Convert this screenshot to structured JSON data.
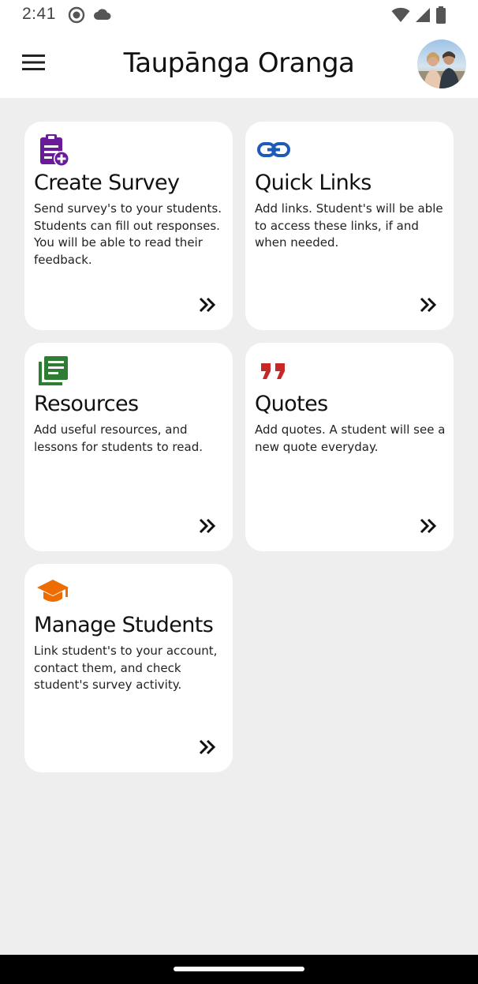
{
  "status_bar": {
    "time": "2:41",
    "left_icons": [
      "github-icon",
      "cloud-icon"
    ],
    "right_icons": [
      "wifi-icon",
      "signal-icon",
      "battery-icon"
    ]
  },
  "app_bar": {
    "menu_icon": "menu-icon",
    "title": "Taupānga Oranga",
    "avatar": "user-avatar"
  },
  "cards": [
    {
      "id": "create-survey",
      "icon": "clipboard-add-icon",
      "icon_color": "#6a1b9a",
      "title": "Create Survey",
      "description": "Send survey's to your students. Students can fill out responses. You will be able to read their feedback.",
      "arrow": "double-chevron-right-icon"
    },
    {
      "id": "quick-links",
      "icon": "link-icon",
      "icon_color": "#1e5bb8",
      "title": "Quick Links",
      "description": "Add links. Student's will be able to access these links, if and when needed.",
      "arrow": "double-chevron-right-icon"
    },
    {
      "id": "resources",
      "icon": "library-books-icon",
      "icon_color": "#2e7d32",
      "title": "Resources",
      "description": "Add useful resources, and lessons for students to read.",
      "arrow": "double-chevron-right-icon"
    },
    {
      "id": "quotes",
      "icon": "quote-icon",
      "icon_color": "#c62828",
      "title": "Quotes",
      "description": "Add quotes. A student will see a new quote everyday.",
      "arrow": "double-chevron-right-icon"
    },
    {
      "id": "manage-students",
      "icon": "graduation-cap-icon",
      "icon_color": "#ef6c00",
      "title": "Manage Students",
      "description": "Link student's to your account, contact them, and check student's survey activity.",
      "arrow": "double-chevron-right-icon"
    }
  ]
}
